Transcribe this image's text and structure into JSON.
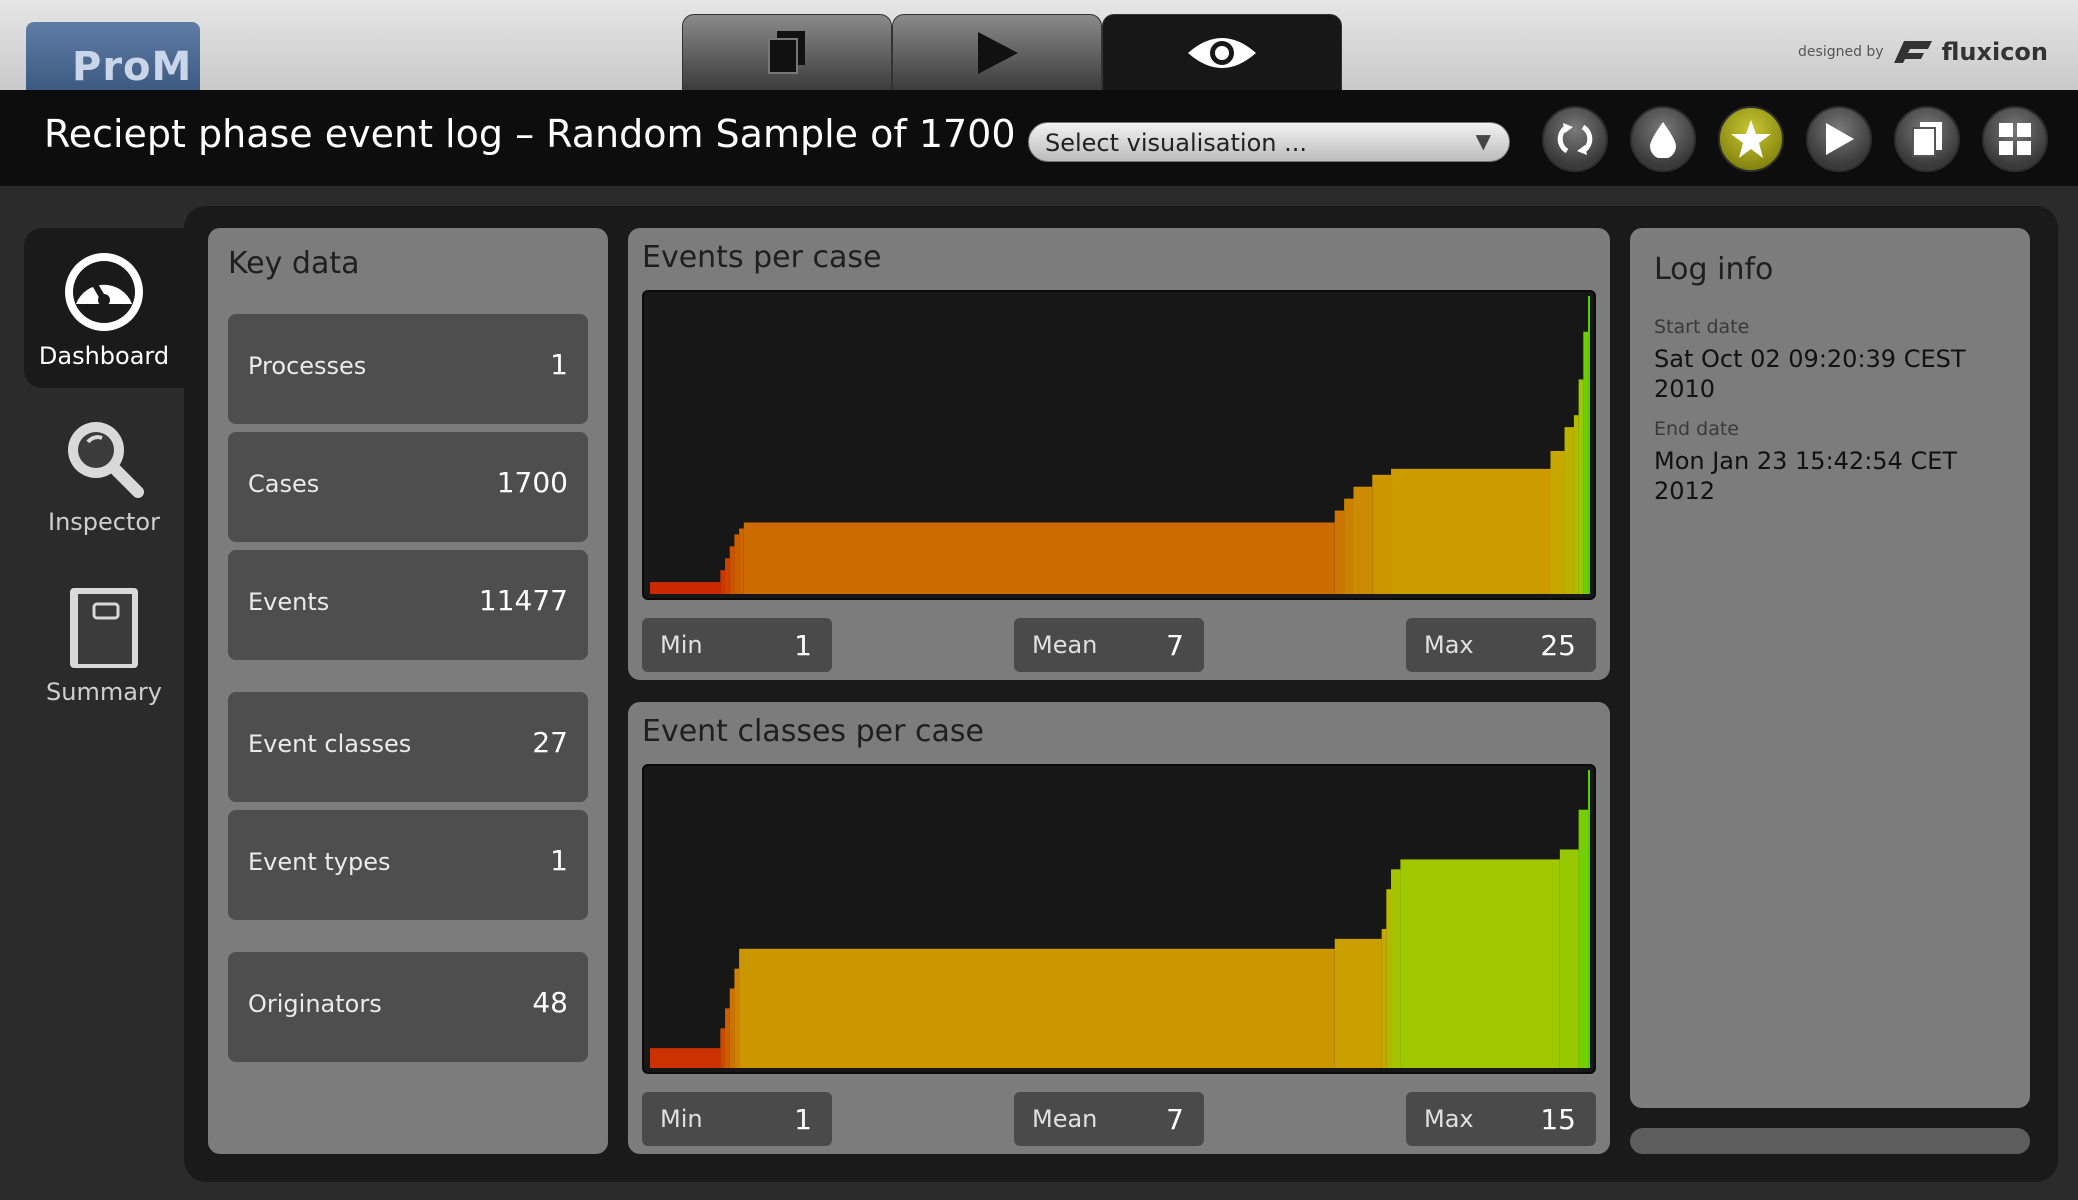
{
  "app": {
    "logo": "ProM",
    "credit_small": "designed by",
    "credit_brand": "fluxicon"
  },
  "view_tabs": [
    {
      "icon": "copy-icon"
    },
    {
      "icon": "play-icon"
    },
    {
      "icon": "eye-icon",
      "active": true
    }
  ],
  "titlebar": {
    "title": "Reciept phase event log – Random Sample of 1700",
    "select_placeholder": "Select visualisation ...",
    "tools": [
      "refresh-icon",
      "drop-icon",
      "star-icon",
      "play-icon",
      "copy-icon",
      "grid-icon"
    ],
    "active_tool": "star-icon"
  },
  "sidebar": {
    "items": [
      {
        "label": "Dashboard",
        "icon": "gauge-icon",
        "active": true
      },
      {
        "label": "Inspector",
        "icon": "magnifier-icon"
      },
      {
        "label": "Summary",
        "icon": "book-icon"
      }
    ]
  },
  "keydata": {
    "title": "Key data",
    "items": [
      {
        "label": "Processes",
        "value": "1"
      },
      {
        "label": "Cases",
        "value": "1700"
      },
      {
        "label": "Events",
        "value": "11477"
      },
      {
        "label": "Event classes",
        "value": "27"
      },
      {
        "label": "Event types",
        "value": "1"
      },
      {
        "label": "Originators",
        "value": "48"
      }
    ]
  },
  "events_per_case": {
    "title": "Events per case",
    "min_label": "Min",
    "min": "1",
    "mean_label": "Mean",
    "mean": "7",
    "max_label": "Max",
    "max": "25"
  },
  "event_classes_per_case": {
    "title": "Event classes per case",
    "min_label": "Min",
    "min": "1",
    "mean_label": "Mean",
    "mean": "7",
    "max_label": "Max",
    "max": "15"
  },
  "loginfo": {
    "title": "Log info",
    "start_label": "Start date",
    "start_value": "Sat Oct 02 09:20:39 CEST 2010",
    "end_label": "End date",
    "end_value": "Mon Jan 23 15:42:54 CET 2012"
  },
  "colors": {
    "accent_active": "#b5b322",
    "red": "#cc1a00",
    "orange": "#cc6000",
    "gold": "#cca300",
    "green": "#7fcc00"
  },
  "chart_data": [
    {
      "type": "area",
      "description_source": "events per case, cases sorted by value",
      "x": [
        0.0,
        0.075,
        0.08,
        0.085,
        0.09,
        0.095,
        0.1,
        0.73,
        0.74,
        0.75,
        0.77,
        0.79,
        0.96,
        0.975,
        0.985,
        0.99,
        0.995,
        1.0
      ],
      "y": [
        1,
        2,
        3,
        4,
        5,
        5.5,
        6,
        7,
        8,
        9,
        10,
        10.5,
        12,
        14,
        15,
        18,
        22,
        25
      ],
      "ylim": [
        0,
        25
      ]
    },
    {
      "type": "area",
      "description_source": "event classes per case, cases sorted by value",
      "x": [
        0.0,
        0.075,
        0.08,
        0.085,
        0.09,
        0.095,
        0.73,
        0.78,
        0.785,
        0.79,
        0.8,
        0.97,
        0.99,
        1.0
      ],
      "y": [
        1,
        2,
        3,
        4,
        5,
        6,
        6.5,
        7,
        9,
        10,
        10.5,
        11,
        13,
        15
      ],
      "ylim": [
        0,
        15
      ]
    }
  ]
}
